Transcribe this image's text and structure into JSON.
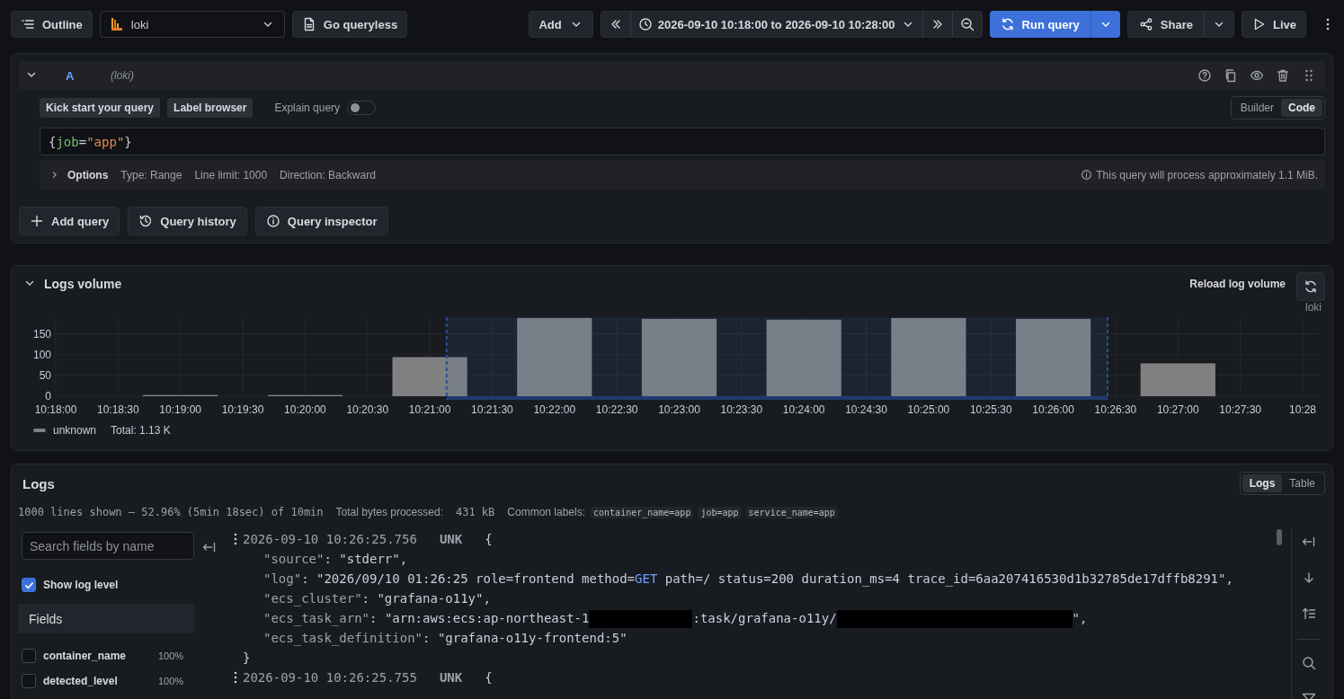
{
  "toolbar": {
    "outline_button": "Outline",
    "datasource": "loki",
    "queryless_button": "Go queryless",
    "add_button": "Add",
    "time_range": "2026-09-10 10:18:00 to 2026-09-10 10:28:00",
    "run_button": "Run query",
    "share_button": "Share",
    "live_button": "Live"
  },
  "query": {
    "letter": "A",
    "datasource": "(loki)",
    "expanded": true,
    "kick_start_button": "Kick start your query",
    "label_browser_button": "Label browser",
    "explain": {
      "label": "Explain query",
      "on": false
    },
    "modes": [
      {
        "label": "Builder",
        "selected": false
      },
      {
        "label": "Code",
        "selected": true
      }
    ],
    "expression": [
      {
        "kind": "punct",
        "text": "{"
      },
      {
        "kind": "label",
        "text": "job"
      },
      {
        "kind": "operator",
        "text": "="
      },
      {
        "kind": "string",
        "text": "\"app\""
      },
      {
        "kind": "punct",
        "text": "}"
      }
    ],
    "options": {
      "expanded": false,
      "label": "Options",
      "details": [
        "Type: Range",
        "Line limit: 1000",
        "Direction: Backward"
      ],
      "estimate": "This query will process approximately 1.1 MiB."
    }
  },
  "query_actions": [
    {
      "kind": "add",
      "label": "Add query"
    },
    {
      "kind": "history",
      "label": "Query history"
    },
    {
      "kind": "inspector",
      "label": "Query inspector"
    }
  ],
  "logs_volume": {
    "title": "Logs volume",
    "expanded": true,
    "reload_label": "Reload log volume",
    "datasource": "loki",
    "total": "Total: 1.13 K",
    "chart_data": {
      "type": "bar",
      "categories": [
        "10:18:00",
        "10:18:30",
        "10:19:00",
        "10:19:30",
        "10:20:00",
        "10:20:30",
        "10:21:00",
        "10:21:30",
        "10:22:00",
        "10:22:30",
        "10:23:00",
        "10:23:30",
        "10:24:00",
        "10:24:30",
        "10:25:00",
        "10:25:30",
        "10:26:00",
        "10:26:30",
        "10:27:00",
        "10:27:30",
        "10:28"
      ],
      "series": [
        {
          "name": "unknown",
          "color": "#808080",
          "values": [
            null,
            null,
            3,
            null,
            3,
            null,
            94,
            null,
            188,
            null,
            186,
            null,
            184,
            null,
            188,
            null,
            186,
            null,
            79,
            null,
            null
          ]
        }
      ],
      "ylim": [
        0,
        190
      ],
      "yticks": [
        0,
        50,
        100,
        150
      ],
      "grid": true
    }
  },
  "logs": {
    "title": "Logs",
    "views": [
      {
        "label": "Logs",
        "selected": true
      },
      {
        "label": "Table",
        "selected": false
      }
    ],
    "summary": "1000 lines shown – 52.96% (5min 18sec) of 10min",
    "bytes_label": "Total bytes processed:",
    "bytes_value": "431 kB",
    "common_labels_label": "Common labels:",
    "common_labels": [
      "container_name=app",
      "job=app",
      "service_name=app"
    ],
    "fields_search": {
      "placeholder": "Search fields by name"
    },
    "show_log_level": {
      "label": "Show log level",
      "checked": true
    },
    "fields_title": "Fields",
    "fields": [
      {
        "name": "container_name",
        "share": "100%",
        "checked": false
      },
      {
        "name": "detected_level",
        "share": "100%",
        "checked": false
      }
    ],
    "entries": [
      {
        "timestamp": "2026-09-10 10:26:25.756",
        "level": "UNK",
        "open": "{",
        "close": "}",
        "lines": [
          {
            "key": "\"source\"",
            "sep": ": ",
            "value": [
              {
                "kind": "text",
                "text": "\"stderr\","
              }
            ]
          },
          {
            "key": "\"log\"",
            "sep": ": ",
            "value": [
              {
                "kind": "text",
                "text": "\"2026/09/10 01:26:25 role=frontend method="
              },
              {
                "kind": "keyword",
                "text": "GET"
              },
              {
                "kind": "text",
                "text": " path=/ status=200 duration_ms=4 trace_id=6aa207416530d1b32785de17dffb8291\","
              }
            ]
          },
          {
            "key": "\"ecs_cluster\"",
            "sep": ": ",
            "value": [
              {
                "kind": "text",
                "text": "\"grafana-o11y\","
              }
            ]
          },
          {
            "key": "\"ecs_task_arn\"",
            "sep": ": ",
            "value": [
              {
                "kind": "text",
                "text": "\"arn:aws:ecs:ap-northeast-1"
              },
              {
                "kind": "redacted"
              },
              {
                "kind": "text",
                "text": ":task/grafana-o11y/"
              },
              {
                "kind": "redacted_wide"
              },
              {
                "kind": "text",
                "text": "\","
              }
            ]
          },
          {
            "key": "\"ecs_task_definition\"",
            "sep": ": ",
            "value": [
              {
                "kind": "text",
                "text": "\"grafana-o11y-frontend:5\""
              }
            ]
          }
        ]
      },
      {
        "timestamp": "2026-09-10 10:26:25.755",
        "level": "UNK",
        "open": "{"
      }
    ]
  }
}
